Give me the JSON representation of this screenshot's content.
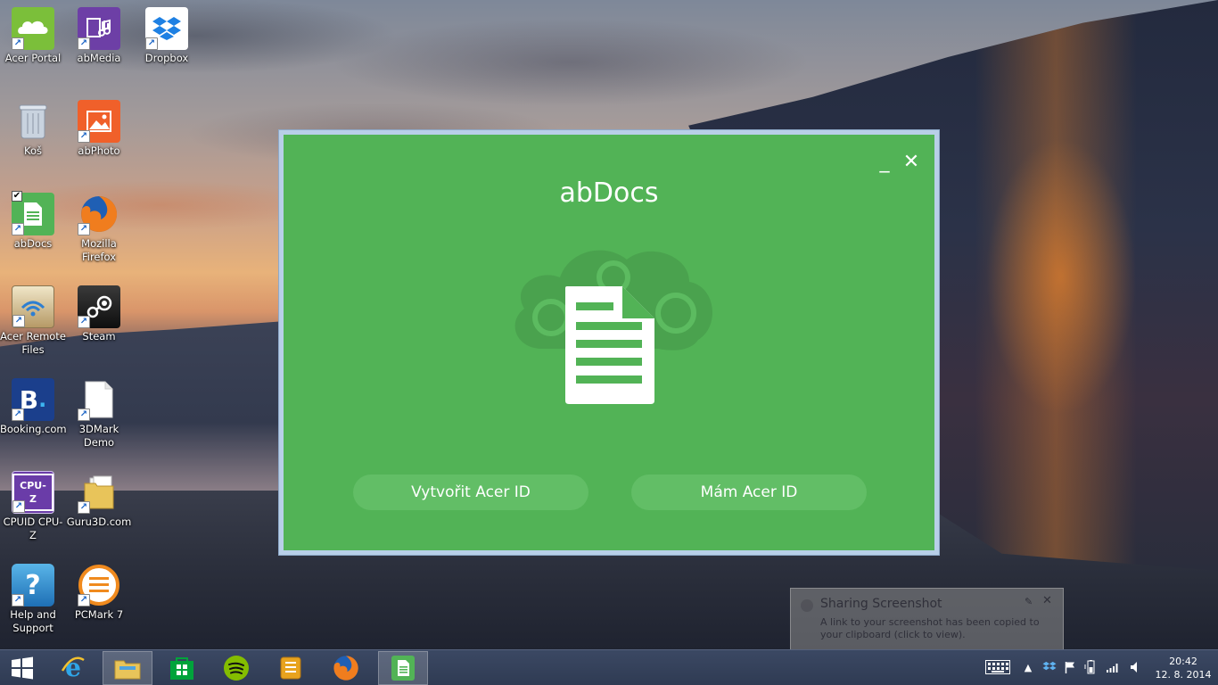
{
  "desktop": {
    "icons": [
      {
        "label": "Acer Portal",
        "icon": "acer-portal-icon"
      },
      {
        "label": "abMedia",
        "icon": "abmedia-icon"
      },
      {
        "label": "Dropbox",
        "icon": "dropbox-icon"
      },
      {
        "label": "Koš",
        "icon": "recycle-bin-icon"
      },
      {
        "label": "abPhoto",
        "icon": "abphoto-icon"
      },
      {
        "label": "abDocs",
        "icon": "abdocs-icon"
      },
      {
        "label": "Mozilla Firefox",
        "icon": "firefox-icon"
      },
      {
        "label": "Acer Remote Files",
        "icon": "acer-remote-files-icon"
      },
      {
        "label": "Steam",
        "icon": "steam-icon"
      },
      {
        "label": "Booking.com",
        "icon": "booking-icon"
      },
      {
        "label": "3DMark Demo",
        "icon": "document-icon"
      },
      {
        "label": "CPUID CPU-Z",
        "icon": "cpuz-icon"
      },
      {
        "label": "Guru3D.com",
        "icon": "folder-icon"
      },
      {
        "label": "Help and Support",
        "icon": "help-icon"
      },
      {
        "label": "PCMark 7",
        "icon": "pcmark-icon"
      }
    ]
  },
  "dialog": {
    "title": "abDocs",
    "minimize_glyph": "_",
    "close_glyph": "✕",
    "create_button": "Vytvořit Acer ID",
    "have_button": "Mám Acer ID",
    "bg_color": "#52b356"
  },
  "toast": {
    "title": "Sharing Screenshot",
    "body": "A link to your screenshot has been copied to your clipboard (click to view)."
  },
  "taskbar": {
    "pinned": [
      "windows-start-icon",
      "internet-explorer-icon",
      "file-explorer-icon",
      "windows-store-icon",
      "spotify-icon",
      "notes-app-icon",
      "firefox-icon",
      "abdocs-icon"
    ],
    "clock": {
      "time": "20:42",
      "date": "12. 8. 2014"
    }
  }
}
